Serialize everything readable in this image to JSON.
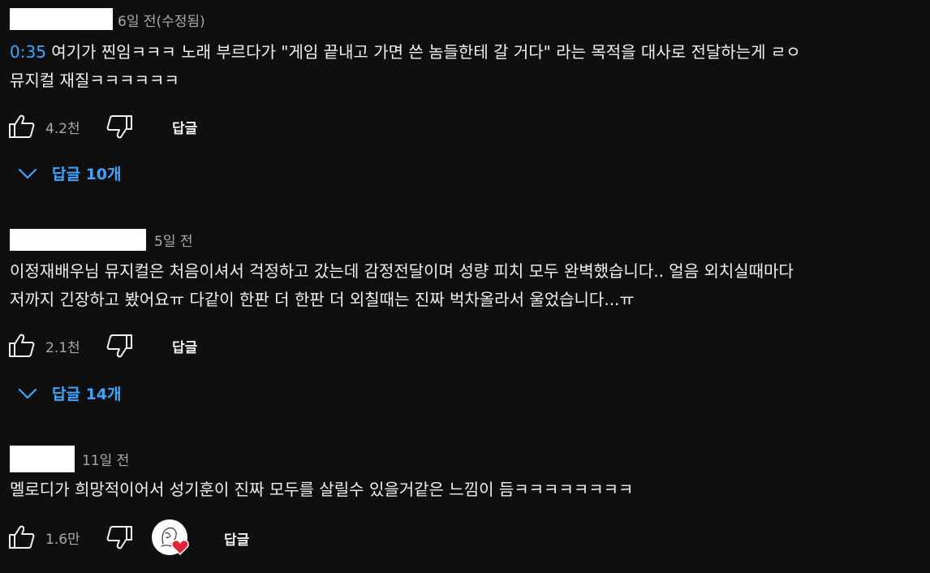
{
  "comments": [
    {
      "time": "6일 전(수정됨)",
      "timestamp_link": "0:35",
      "line1": " 여기가 찐임ㅋㅋㅋ 노래 부르다가 \"게임 끝내고 가면 쓴 놈들한테 갈 거다\" 라는 목적을 대사로 전달하는게 ㄹㅇ",
      "line2": "뮤지컬 재질ㅋㅋㅋㅋㅋㅋ",
      "likes": "4.2천",
      "reply_label": "답글",
      "replies_label": "답글 10개"
    },
    {
      "time": "5일 전",
      "line1": "이정재배우님 뮤지컬은 처음이셔서 걱정하고 갔는데 감정전달이며 성량 피치 모두 완벽했습니다.. 얼음 외치실때마다",
      "line2": "저까지 긴장하고 봤어요ㅠ 다같이 한판 더 한판 더 외칠때는 진짜 벅차올라서 울었습니다...ㅠ",
      "likes": "2.1천",
      "reply_label": "답글",
      "replies_label": "답글 14개"
    },
    {
      "time": "11일 전",
      "line1": "멜로디가 희망적이어서 성기훈이 진짜 모두를 살릴수 있을거같은 느낌이 듬ㅋㅋㅋㅋㅋㅋㅋㅋ",
      "likes": "1.6만",
      "reply_label": "답글"
    }
  ],
  "colors": {
    "background": "#0f0f0f",
    "text": "#f1f1f1",
    "secondary_text": "#aaaaaa",
    "link_blue": "#3ea6ff",
    "heart_red": "#e0243a"
  },
  "icons": [
    "like-icon",
    "dislike-icon",
    "chevron-down-icon",
    "creator-heart-icon"
  ]
}
